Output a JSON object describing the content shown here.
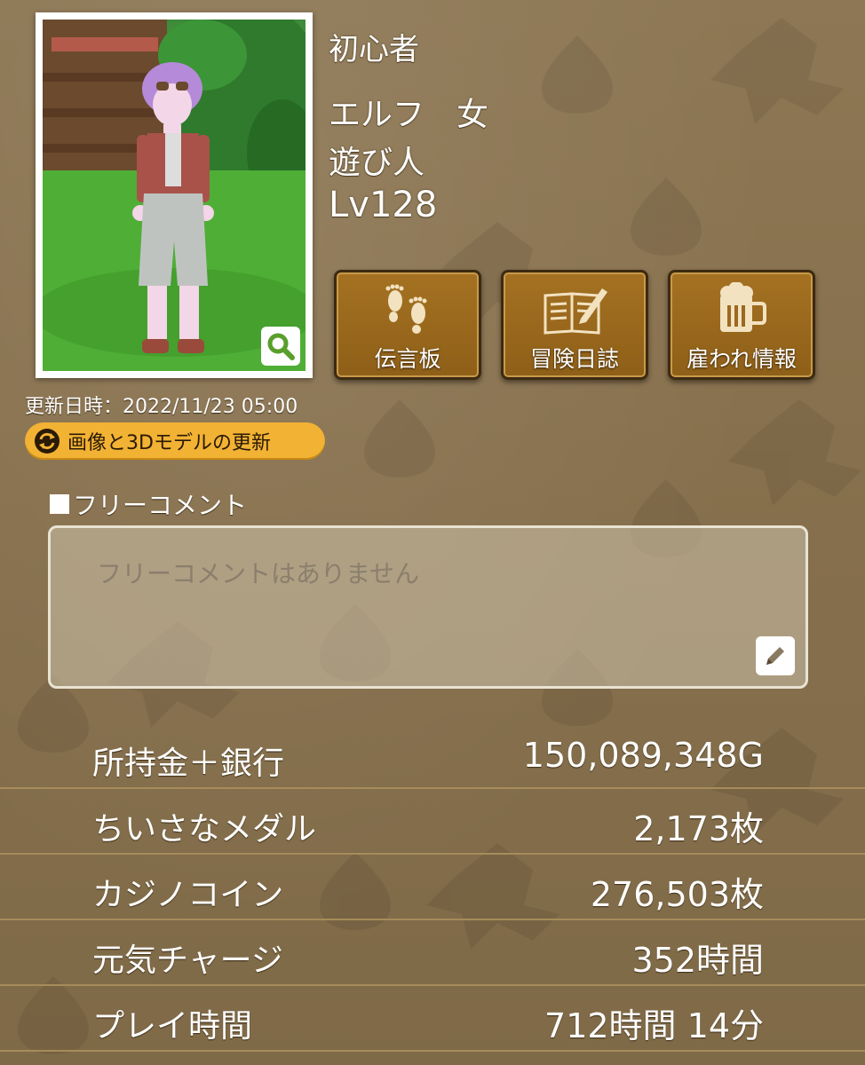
{
  "character": {
    "title": "初心者",
    "race_sex": "エルフ　女",
    "job": "遊び人",
    "level": "Lv128"
  },
  "actions": [
    {
      "label": "伝言板",
      "icon": "footprints-icon"
    },
    {
      "label": "冒険日誌",
      "icon": "journal-icon"
    },
    {
      "label": "雇われ情報",
      "icon": "beer-mug-icon"
    }
  ],
  "portrait": {
    "updated": "更新日時：2022/11/23  05:00",
    "refresh_label": "画像と3Dモデルの更新"
  },
  "comment": {
    "heading": "フリーコメント",
    "text": "フリーコメントはありません"
  },
  "stats": [
    {
      "label": "所持金＋銀行",
      "value": "150,089,348G"
    },
    {
      "label": "ちいさなメダル",
      "value": "2,173枚"
    },
    {
      "label": "カジノコイン",
      "value": "276,503枚"
    },
    {
      "label": "元気チャージ",
      "value": "352時間"
    },
    {
      "label": "プレイ時間",
      "value": "712時間  14分"
    }
  ],
  "colors": {
    "background": "#8a7553",
    "button_brown": "#9a6a1e",
    "refresh_yellow": "#f2b233"
  }
}
